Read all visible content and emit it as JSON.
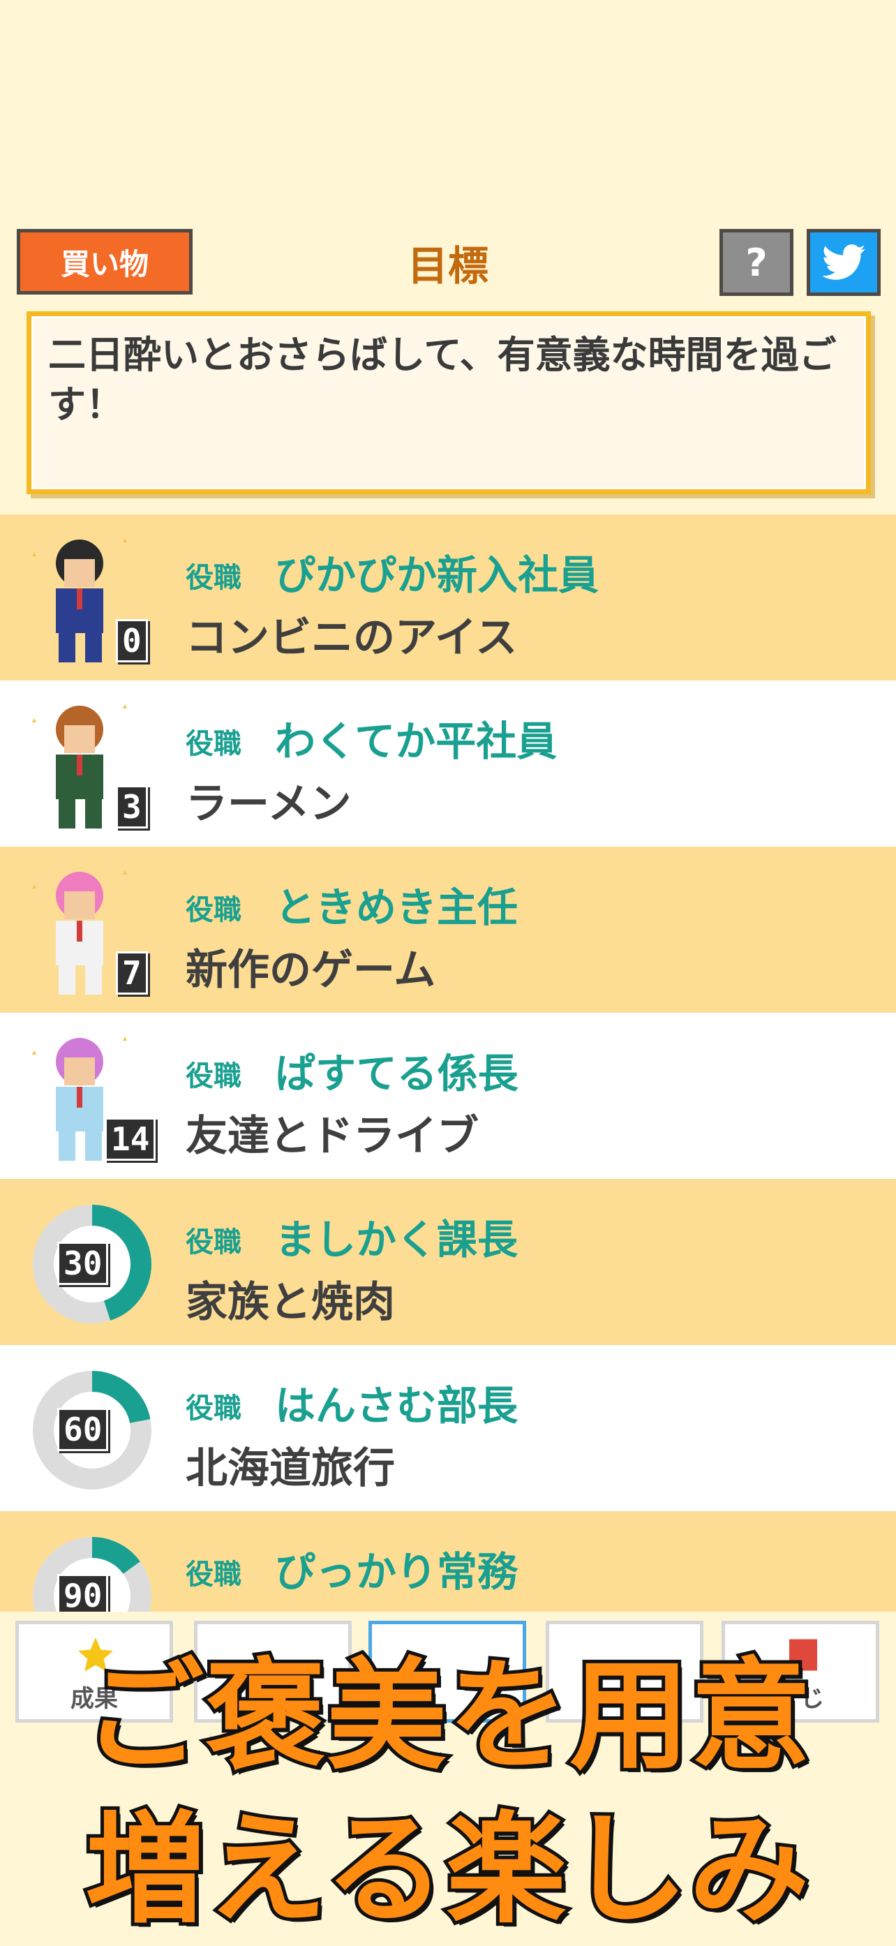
{
  "header": {
    "shop_label": "買い物",
    "title": "目標",
    "help_label": "?",
    "twitter_icon": "twitter-bird-icon"
  },
  "goal": {
    "text": "二日酔いとおさらばして、有意義な時間を過ごす！"
  },
  "levels": [
    {
      "role_label": "役職",
      "role": "ぴかぴか新入社員",
      "reward": "コンビニのアイス",
      "days": "0",
      "kind": "character",
      "hair": "#2a2a2a",
      "suit": "#2c3e8f"
    },
    {
      "role_label": "役職",
      "role": "わくてか平社員",
      "reward": "ラーメン",
      "days": "3",
      "kind": "character",
      "hair": "#b5652a",
      "suit": "#2f5e3a"
    },
    {
      "role_label": "役職",
      "role": "ときめき主任",
      "reward": "新作のゲーム",
      "days": "7",
      "kind": "character",
      "hair": "#f07cc0",
      "suit": "#f2f2f2"
    },
    {
      "role_label": "役職",
      "role": "ぱすてる係長",
      "reward": "友達とドライブ",
      "days": "14",
      "kind": "character",
      "hair": "#d07ad8",
      "suit": "#a7d8f0"
    },
    {
      "role_label": "役職",
      "role": "ましかく課長",
      "reward": "家族と焼肉",
      "days": "30",
      "kind": "progress",
      "progress": 0.45
    },
    {
      "role_label": "役職",
      "role": "はんさむ部長",
      "reward": "北海道旅行",
      "days": "60",
      "kind": "progress",
      "progress": 0.22
    },
    {
      "role_label": "役職",
      "role": "ぴっかり常務",
      "reward": "",
      "days": "90",
      "kind": "progress",
      "progress": 0.15
    }
  ],
  "tabs": [
    {
      "label": "成果",
      "icon": "star-icon",
      "active": false
    },
    {
      "label": "",
      "icon": "",
      "active": false
    },
    {
      "label": "",
      "icon": "",
      "active": true
    },
    {
      "label": "",
      "icon": "",
      "active": false
    },
    {
      "label": "くじ",
      "icon": "lottery-icon",
      "active": false
    }
  ],
  "promo": {
    "line1": "ご褒美を用意",
    "line2": "増える楽しみ"
  },
  "colors": {
    "background": "#fff6d6",
    "row_odd": "#fddd93",
    "row_even": "#ffffff",
    "accent_teal": "#1aa090",
    "shop_orange": "#f46a27",
    "title_brown": "#c26a0e",
    "goal_border": "#f5b921",
    "twitter_blue": "#1da1f2"
  }
}
